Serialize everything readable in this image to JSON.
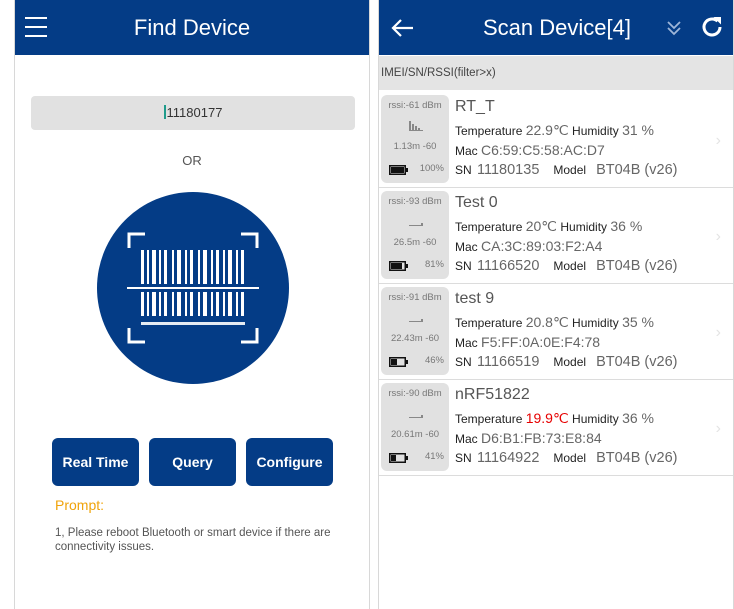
{
  "left": {
    "title": "Find Device",
    "search_value": "11180177",
    "or_label": "OR",
    "buttons": {
      "realtime": "Real Time",
      "query": "Query",
      "configure": "Configure"
    },
    "prompt_title": "Prompt:",
    "prompt_text": "1, Please reboot Bluetooth or smart device if there are connectivity issues."
  },
  "right": {
    "title": "Scan Device[4]",
    "filter_placeholder": "IMEI/SN/RSSI(filter>x)",
    "labels": {
      "temperature": "Temperature",
      "humidity": "Humidity",
      "mac": "Mac",
      "sn": "SN",
      "model": "Model"
    },
    "devices": [
      {
        "name": "RT_T",
        "rssi": "rssi:-61 dBm",
        "distance": "1.13m -60",
        "battery": "100%",
        "battery_level": 1.0,
        "temperature": "22.9℃",
        "humidity": "31 %",
        "mac": "C6:59:C5:58:AC:D7",
        "sn": "11180135",
        "model": "BT04B (v26)",
        "alert": false
      },
      {
        "name": "Test 0",
        "rssi": "rssi:-93 dBm",
        "distance": "26.5m -60",
        "battery": "81%",
        "battery_level": 0.81,
        "temperature": "20℃",
        "humidity": "36 %",
        "mac": "CA:3C:89:03:F2:A4",
        "sn": "11166520",
        "model": "BT04B (v26)",
        "alert": false
      },
      {
        "name": "test 9",
        "rssi": "rssi:-91 dBm",
        "distance": "22.43m -60",
        "battery": "46%",
        "battery_level": 0.46,
        "temperature": "20.8℃",
        "humidity": "35 %",
        "mac": "F5:FF:0A:0E:F4:78",
        "sn": "11166519",
        "model": "BT04B (v26)",
        "alert": false
      },
      {
        "name": "nRF51822",
        "rssi": "rssi:-90 dBm",
        "distance": "20.61m -60",
        "battery": "41%",
        "battery_level": 0.41,
        "temperature": "19.9℃",
        "humidity": "36 %",
        "mac": "D6:B1:FB:73:E8:84",
        "sn": "11164922",
        "model": "BT04B (v26)",
        "alert": true
      }
    ]
  },
  "colors": {
    "brand": "#043c86",
    "prompt": "#f0a30a",
    "alert": "#e60000"
  }
}
